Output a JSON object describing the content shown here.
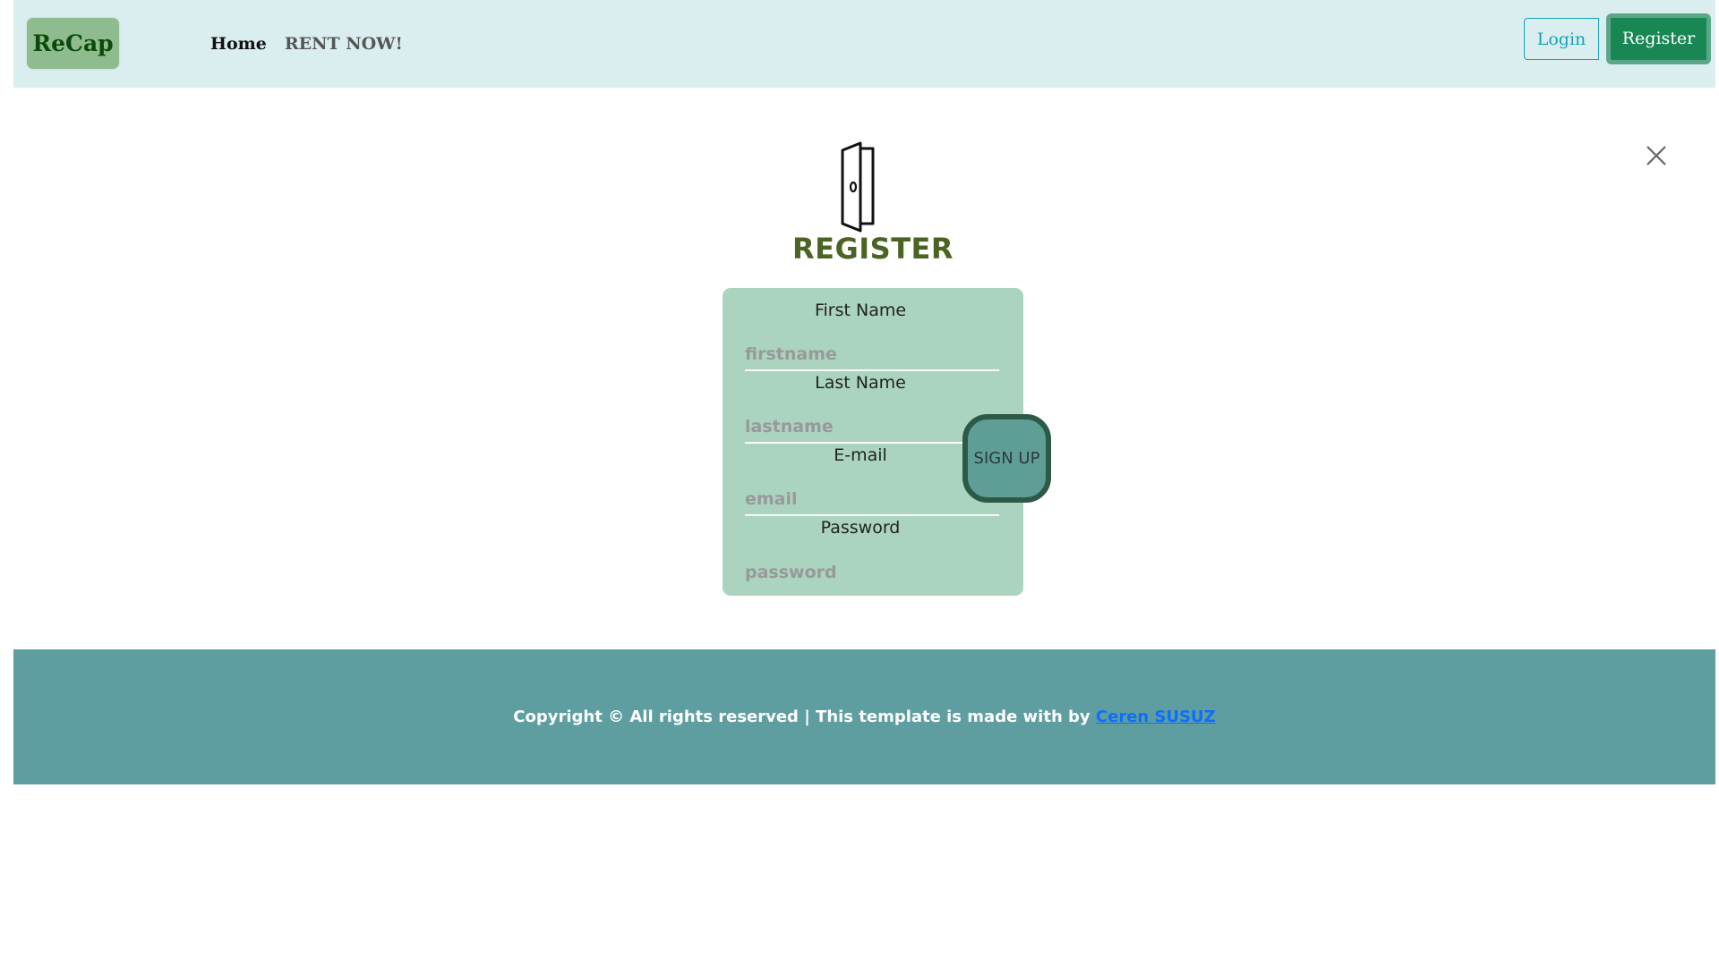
{
  "navbar": {
    "brand": "ReCap",
    "links": [
      "Home",
      "RENT NOW!"
    ],
    "login_label": "Login",
    "register_label": "Register"
  },
  "modal": {
    "title": "REGISTER",
    "close_icon": "close-icon",
    "door_icon": "door-icon",
    "fields": [
      {
        "label": "First Name",
        "placeholder": "firstname"
      },
      {
        "label": "Last Name",
        "placeholder": "lastname"
      },
      {
        "label": "E-mail",
        "placeholder": "email"
      },
      {
        "label": "Password",
        "placeholder": "password"
      }
    ],
    "signup_label": "SIGN UP"
  },
  "footer": {
    "text": "Copyright © All rights reserved | This template is made with by ",
    "author": "Ceren SUSUZ"
  },
  "colors": {
    "navbar_bg": "#daeeef",
    "brand_bg": "#8fbc8f",
    "register_btn": "#198754",
    "form_bg": "#aad4c0",
    "title": "#4b6424",
    "footer_bg": "#5f9ea0"
  }
}
